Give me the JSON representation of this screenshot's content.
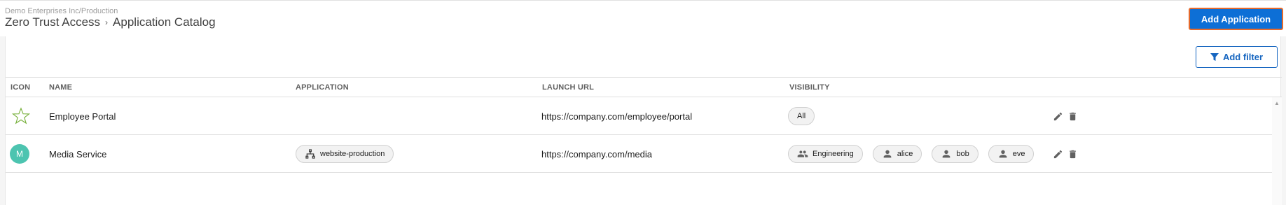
{
  "header": {
    "org_path": "Demo Enterprises Inc/Production",
    "breadcrumb": {
      "root": "Zero Trust Access",
      "separator": "›",
      "current": "Application Catalog"
    },
    "add_application_label": "Add Application"
  },
  "toolbar": {
    "add_filter_label": "Add filter"
  },
  "table": {
    "columns": [
      "ICON",
      "NAME",
      "APPLICATION",
      "LAUNCH URL",
      "VISIBILITY"
    ],
    "rows": [
      {
        "icon": "star-outline-icon",
        "name": "Employee Portal",
        "application": "",
        "launch_url": "https://company.com/employee/portal",
        "visibility": [
          {
            "label": "All",
            "icon": ""
          }
        ]
      },
      {
        "icon": "avatar",
        "avatar_letter": "M",
        "name": "Media Service",
        "application": "website-production",
        "launch_url": "https://company.com/media",
        "visibility": [
          {
            "label": "Engineering",
            "icon": "group-icon"
          },
          {
            "label": "alice",
            "icon": "person-icon"
          },
          {
            "label": "bob",
            "icon": "person-icon"
          },
          {
            "label": "eve",
            "icon": "person-icon"
          }
        ]
      }
    ]
  },
  "colors": {
    "primary": "#0d6fd6",
    "accent_outline": "#e56a2c",
    "avatar": "#4dc4b0",
    "star": "#7cb342"
  }
}
